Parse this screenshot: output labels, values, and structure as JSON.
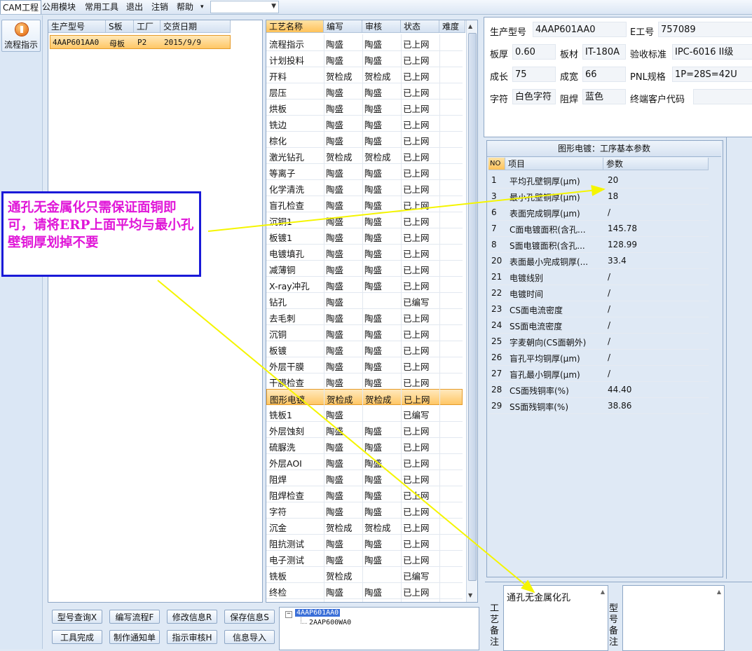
{
  "menu": {
    "items": [
      "CAM工程",
      "公用模块",
      "常用工具",
      "退出",
      "注销",
      "帮助"
    ],
    "help_arrow": "▾",
    "dropdown_value": ""
  },
  "sidebar": {
    "flow_button_label": "流程指示"
  },
  "product_table": {
    "columns": [
      "生产型号",
      "S板",
      "工厂",
      "交货日期"
    ],
    "rows": [
      {
        "model": "4AAP601AA0",
        "board": "母板",
        "factory": "P2",
        "date": "2015/9/9"
      }
    ]
  },
  "process_table": {
    "columns": [
      "工艺名称",
      "编写",
      "审核",
      "状态",
      "难度"
    ],
    "rows": [
      [
        "流程指示",
        "陶盛",
        "陶盛",
        "已上网"
      ],
      [
        "计划投料",
        "陶盛",
        "陶盛",
        "已上网"
      ],
      [
        "开料",
        "贺检成",
        "贺检成",
        "已上网"
      ],
      [
        "层压",
        "陶盛",
        "陶盛",
        "已上网"
      ],
      [
        "烘板",
        "陶盛",
        "陶盛",
        "已上网"
      ],
      [
        "铣边",
        "陶盛",
        "陶盛",
        "已上网"
      ],
      [
        "棕化",
        "陶盛",
        "陶盛",
        "已上网"
      ],
      [
        "激光钻孔",
        "贺检成",
        "贺检成",
        "已上网"
      ],
      [
        "等离子",
        "陶盛",
        "陶盛",
        "已上网"
      ],
      [
        "化学清洗",
        "陶盛",
        "陶盛",
        "已上网"
      ],
      [
        "盲孔检查",
        "陶盛",
        "陶盛",
        "已上网"
      ],
      [
        "沉铜1",
        "陶盛",
        "陶盛",
        "已上网"
      ],
      [
        "板镀1",
        "陶盛",
        "陶盛",
        "已上网"
      ],
      [
        "电镀填孔",
        "陶盛",
        "陶盛",
        "已上网"
      ],
      [
        "减薄铜",
        "陶盛",
        "陶盛",
        "已上网"
      ],
      [
        "X-ray冲孔",
        "陶盛",
        "陶盛",
        "已上网"
      ],
      [
        "钻孔",
        "陶盛",
        "",
        "已编写"
      ],
      [
        "去毛刺",
        "陶盛",
        "陶盛",
        "已上网"
      ],
      [
        "沉铜",
        "陶盛",
        "陶盛",
        "已上网"
      ],
      [
        "板镀",
        "陶盛",
        "陶盛",
        "已上网"
      ],
      [
        "外层干膜",
        "陶盛",
        "陶盛",
        "已上网"
      ],
      [
        "干膜检查",
        "陶盛",
        "陶盛",
        "已上网"
      ],
      [
        "图形电镀",
        "贺检成",
        "贺检成",
        "已上网"
      ],
      [
        "铣板1",
        "陶盛",
        "",
        "已编写"
      ],
      [
        "外层蚀刻",
        "陶盛",
        "陶盛",
        "已上网"
      ],
      [
        "硫脲洗",
        "陶盛",
        "陶盛",
        "已上网"
      ],
      [
        "外层AOI",
        "陶盛",
        "陶盛",
        "已上网"
      ],
      [
        "阻焊",
        "陶盛",
        "陶盛",
        "已上网"
      ],
      [
        "阻焊检查",
        "陶盛",
        "陶盛",
        "已上网"
      ],
      [
        "字符",
        "陶盛",
        "陶盛",
        "已上网"
      ],
      [
        "沉金",
        "贺检成",
        "贺检成",
        "已上网"
      ],
      [
        "阻抗测试",
        "陶盛",
        "陶盛",
        "已上网"
      ],
      [
        "电子测试",
        "陶盛",
        "陶盛",
        "已上网"
      ],
      [
        "铣板",
        "贺检成",
        "",
        "已编写"
      ],
      [
        "终检",
        "陶盛",
        "陶盛",
        "已上网"
      ]
    ],
    "selected_index": 22
  },
  "info": {
    "model_label": "生产型号",
    "model_value": "4AAP601AA0",
    "eng_label": "E工号",
    "eng_value": "757089",
    "thickness_label": "板厚",
    "thickness_value": "0.60",
    "material_label": "板材",
    "material_value": "IT-180A",
    "standard_label": "验收标准",
    "standard_value": "IPC-6016 II级",
    "length_label": "成长",
    "length_value": "75",
    "width_label": "成宽",
    "width_value": "66",
    "pnl_label": "PNL规格",
    "pnl_value": "1P=28S=42U",
    "char_label": "字符",
    "char_value": "白色字符",
    "mask_label": "阻焊",
    "mask_value": "蓝色",
    "customer_label": "终端客户代码",
    "customer_value": ""
  },
  "params": {
    "title": "图形电镀：工序基本参数",
    "columns": [
      "NO",
      "项目",
      "参数"
    ],
    "rows": [
      [
        "1",
        "平均孔壁铜厚(μm)",
        "20"
      ],
      [
        "3",
        "最小孔壁铜厚(μm)",
        "18"
      ],
      [
        "6",
        "表面完成铜厚(μm)",
        "/"
      ],
      [
        "7",
        "C面电镀面积(含孔...",
        "145.78"
      ],
      [
        "8",
        "S面电镀面积(含孔...",
        "128.99"
      ],
      [
        "20",
        "表面最小完成铜厚(...",
        "33.4"
      ],
      [
        "21",
        "电镀线别",
        "/"
      ],
      [
        "22",
        "电镀时间",
        "/"
      ],
      [
        "23",
        "CS面电流密度",
        "/"
      ],
      [
        "24",
        "SS面电流密度",
        "/"
      ],
      [
        "25",
        "字麦朝向(CS面朝外)",
        "/"
      ],
      [
        "26",
        "盲孔平均铜厚(μm)",
        "/"
      ],
      [
        "27",
        "盲孔最小铜厚(μm)",
        "/"
      ],
      [
        "28",
        "CS面残铜率(%)",
        "44.40"
      ],
      [
        "29",
        "SS面残铜率(%)",
        "38.86"
      ]
    ]
  },
  "buttons": {
    "query": "型号查询X",
    "write_flow": "编写流程F",
    "modify": "修改信息R",
    "save": "保存信息S",
    "tool_done": "工具完成",
    "notice": "制作通知单",
    "review": "指示审核H",
    "import": "信息导入"
  },
  "tree": {
    "root": "4AAP601AA0",
    "child": "2AAP600WA0"
  },
  "remarks": {
    "process_label": "工艺备注",
    "process_text": "通孔无金属化孔",
    "model_label": "型号备注"
  },
  "annotation": {
    "text": "通孔无金属化只需保证面铜即可，请将ERP上面平均与最小孔壁铜厚划掉不要",
    "border_color": "#1a1ad8",
    "text_color": "#e016d8",
    "arrow_color": "#f5f500"
  },
  "colors": {
    "selection": "#ffc766",
    "panel_bg": "#dfe9f5"
  }
}
